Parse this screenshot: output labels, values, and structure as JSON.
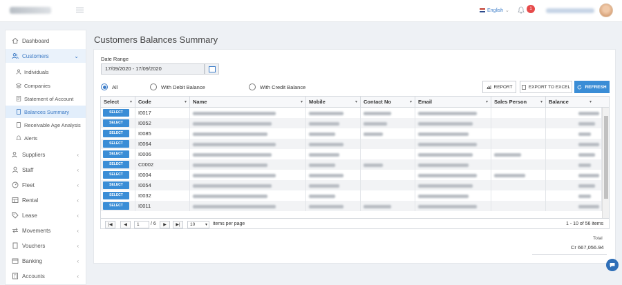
{
  "header": {
    "language": "English",
    "notification_count": "1"
  },
  "sidebar": {
    "items": [
      {
        "label": "Dashboard",
        "icon": "home-icon"
      },
      {
        "label": "Customers",
        "icon": "users-icon"
      },
      {
        "label": "Suppliers",
        "icon": "users-icon"
      },
      {
        "label": "Staff",
        "icon": "user-icon"
      },
      {
        "label": "Fleet",
        "icon": "gauge-icon"
      },
      {
        "label": "Rental",
        "icon": "table-icon"
      },
      {
        "label": "Lease",
        "icon": "tag-icon"
      },
      {
        "label": "Movements",
        "icon": "arrows-icon"
      },
      {
        "label": "Vouchers",
        "icon": "doc-icon"
      },
      {
        "label": "Banking",
        "icon": "bank-icon"
      },
      {
        "label": "Accounts",
        "icon": "calc-icon"
      }
    ],
    "sub_items": [
      {
        "label": "Individuals",
        "icon": "person-icon"
      },
      {
        "label": "Companies",
        "icon": "stack-icon"
      },
      {
        "label": "Statement of Account",
        "icon": "doc-icon"
      },
      {
        "label": "Balances Summary",
        "icon": "doc-icon"
      },
      {
        "label": "Receivable Age Analysis",
        "icon": "doc-icon"
      },
      {
        "label": "Alerts",
        "icon": "bell-icon"
      }
    ]
  },
  "page": {
    "title": "Customers Balances Summary",
    "date_range_label": "Date Range",
    "date_range_value": "17/09/2020 - 17/09/2020",
    "radios": [
      "All",
      "With Debit Balance",
      "With Credit Balance"
    ],
    "buttons": {
      "report": "REPORT",
      "export": "EXPORT TO EXCEL",
      "refresh": "REFRESH"
    }
  },
  "grid": {
    "columns": [
      "Select",
      "Code",
      "Name",
      "Mobile",
      "Contact No",
      "Email",
      "Sales Person",
      "Balance"
    ],
    "select_label": "SELECT",
    "rows": [
      {
        "code": "I0017"
      },
      {
        "code": "I0052"
      },
      {
        "code": "I0085"
      },
      {
        "code": "I0064"
      },
      {
        "code": "I0006"
      },
      {
        "code": "C0002"
      },
      {
        "code": "I0004"
      },
      {
        "code": "I0054"
      },
      {
        "code": "I0032"
      },
      {
        "code": "I0011"
      }
    ],
    "pager": {
      "current_page": "1",
      "of_pages": "/ 6",
      "page_size": "10",
      "items_per_page": "items per page",
      "summary": "1 - 10 of 56 items"
    }
  },
  "totals": {
    "label": "Total",
    "value": "Cr 667,056.94"
  }
}
